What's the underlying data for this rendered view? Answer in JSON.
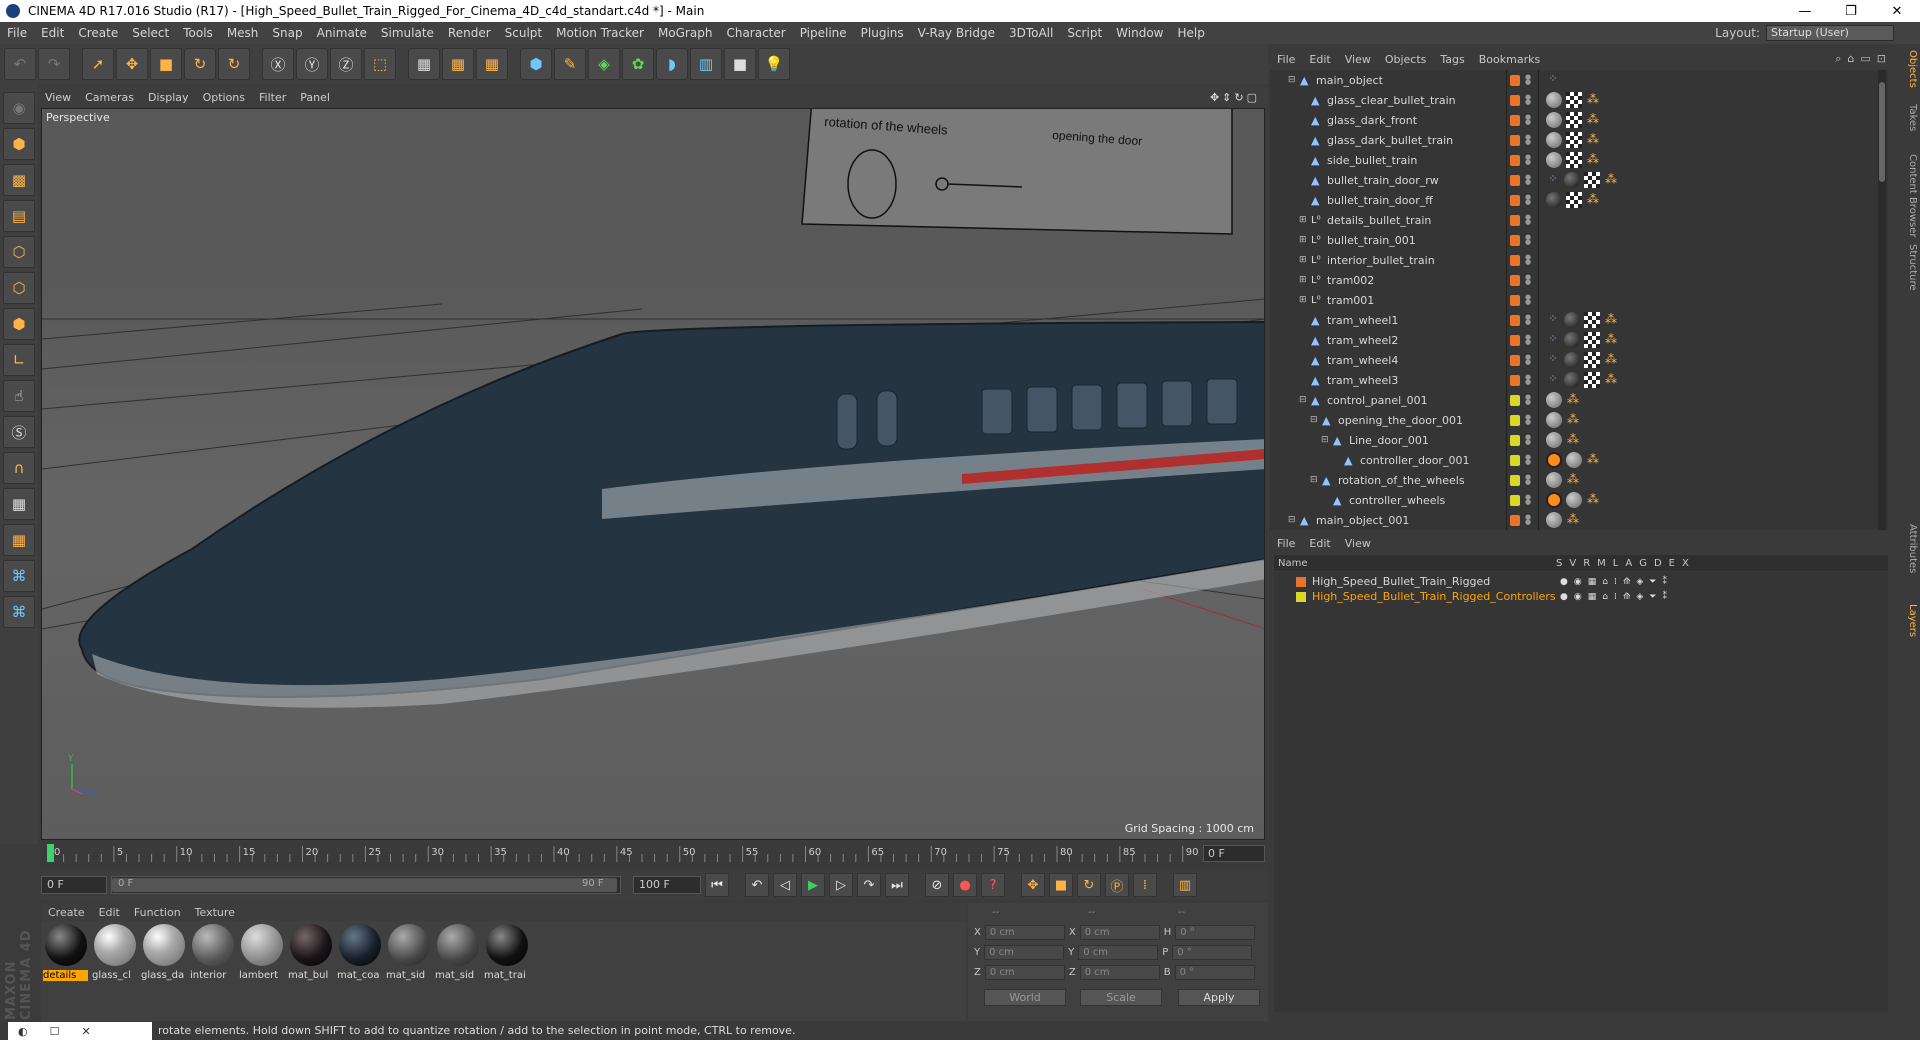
{
  "window": {
    "title": "CINEMA 4D R17.016 Studio (R17) - [High_Speed_Bullet_Train_Rigged_For_Cinema_4D_c4d_standart.c4d *] - Main"
  },
  "menubar": {
    "items": [
      "File",
      "Edit",
      "Create",
      "Select",
      "Tools",
      "Mesh",
      "Snap",
      "Animate",
      "Simulate",
      "Render",
      "Sculpt",
      "Motion Tracker",
      "MoGraph",
      "Character",
      "Pipeline",
      "Plugins",
      "V-Ray Bridge",
      "3DToAll",
      "Script",
      "Window",
      "Help"
    ],
    "layout_label": "Layout:",
    "layout_value": "Startup (User)"
  },
  "viewport": {
    "menu": [
      "View",
      "Cameras",
      "Display",
      "Options",
      "Filter",
      "Panel"
    ],
    "camera_label": "Perspective",
    "grid_spacing": "Grid Spacing : 1000 cm",
    "panel_text_wheels": "rotation of the wheels",
    "panel_text_door": "opening the door",
    "axis_y": "Y",
    "axis_z": "Z"
  },
  "timeline": {
    "ticks": [
      "0",
      "5",
      "10",
      "15",
      "20",
      "25",
      "30",
      "35",
      "40",
      "45",
      "50",
      "55",
      "60",
      "65",
      "70",
      "75",
      "80",
      "85",
      "90"
    ],
    "current_frame": "0 F"
  },
  "anim": {
    "start": "0 F",
    "range_start": "0 F",
    "range_end": "90 F",
    "end": "100 F"
  },
  "materials": {
    "menu": [
      "Create",
      "Edit",
      "Function",
      "Texture"
    ],
    "items": [
      {
        "name": "details",
        "style": "dark",
        "selected": true
      },
      {
        "name": "glass_cl",
        "style": "glass",
        "selected": false
      },
      {
        "name": "glass_da",
        "style": "glass",
        "selected": false
      },
      {
        "name": "interior",
        "style": "gray",
        "selected": false
      },
      {
        "name": "lambert",
        "style": "light",
        "selected": false
      },
      {
        "name": "mat_bul",
        "style": "darkred",
        "selected": false
      },
      {
        "name": "mat_coa",
        "style": "darkblue",
        "selected": false
      },
      {
        "name": "mat_sid",
        "style": "grayd",
        "selected": false
      },
      {
        "name": "mat_sid",
        "style": "grayd",
        "selected": false
      },
      {
        "name": "mat_trai",
        "style": "dark",
        "selected": false
      }
    ]
  },
  "coords": {
    "header": [
      "--",
      "--",
      "--"
    ],
    "rows": [
      {
        "l1": "X",
        "v1": "0 cm",
        "l2": "X",
        "v2": "0 cm",
        "l3": "H",
        "v3": "0 °"
      },
      {
        "l1": "Y",
        "v1": "0 cm",
        "l2": "Y",
        "v2": "0 cm",
        "l3": "P",
        "v3": "0 °"
      },
      {
        "l1": "Z",
        "v1": "0 cm",
        "l2": "Z",
        "v2": "0 cm",
        "l3": "B",
        "v3": "0 °"
      }
    ],
    "mode1": "World",
    "mode2": "Scale",
    "apply": "Apply"
  },
  "status": {
    "text": "rotate elements. Hold down SHIFT to add to quantize rotation / add to the selection in point mode, CTRL to remove."
  },
  "objects": {
    "menu": [
      "File",
      "Edit",
      "View",
      "Objects",
      "Tags",
      "Bookmarks"
    ],
    "rows": [
      {
        "name": "main_object",
        "depth": 0,
        "icon": "bone",
        "exp": "⊟",
        "color": "#e8742a",
        "tags": [
          "sk"
        ]
      },
      {
        "name": "glass_clear_bullet_train",
        "depth": 1,
        "icon": "bone",
        "exp": "",
        "color": "#e8742a",
        "tags": [
          "gray",
          "chk",
          "xp"
        ]
      },
      {
        "name": "glass_dark_front",
        "depth": 1,
        "icon": "bone",
        "exp": "",
        "color": "#e8742a",
        "tags": [
          "gray",
          "chk",
          "xp"
        ]
      },
      {
        "name": "glass_dark_bullet_train",
        "depth": 1,
        "icon": "bone",
        "exp": "",
        "color": "#e8742a",
        "tags": [
          "gray",
          "chk",
          "xp"
        ]
      },
      {
        "name": "side_bullet_train",
        "depth": 1,
        "icon": "bone",
        "exp": "",
        "color": "#e8742a",
        "tags": [
          "gray",
          "chk",
          "xp"
        ]
      },
      {
        "name": "bullet_train_door_rw",
        "depth": 1,
        "icon": "bone",
        "exp": "",
        "color": "#e8742a",
        "tags": [
          "sk",
          "dark",
          "chk",
          "xp"
        ]
      },
      {
        "name": "bullet_train_door_ff",
        "depth": 1,
        "icon": "bone",
        "exp": "",
        "color": "#e8742a",
        "tags": [
          "dark",
          "chk",
          "xp"
        ]
      },
      {
        "name": "details_bullet_train",
        "depth": 1,
        "icon": "null",
        "exp": "⊞",
        "color": "#e8742a",
        "tags": []
      },
      {
        "name": "bullet_train_001",
        "depth": 1,
        "icon": "null",
        "exp": "⊞",
        "color": "#e8742a",
        "tags": []
      },
      {
        "name": "interior_bullet_train",
        "depth": 1,
        "icon": "null",
        "exp": "⊞",
        "color": "#e8742a",
        "tags": []
      },
      {
        "name": "tram002",
        "depth": 1,
        "icon": "null",
        "exp": "⊞",
        "color": "#e8742a",
        "tags": []
      },
      {
        "name": "tram001",
        "depth": 1,
        "icon": "null",
        "exp": "⊞",
        "color": "#e8742a",
        "tags": []
      },
      {
        "name": "tram_wheel1",
        "depth": 1,
        "icon": "bone",
        "exp": "",
        "color": "#e8742a",
        "tags": [
          "sk",
          "dark",
          "chk",
          "xp"
        ]
      },
      {
        "name": "tram_wheel2",
        "depth": 1,
        "icon": "bone",
        "exp": "",
        "color": "#e8742a",
        "tags": [
          "sk",
          "dark",
          "chk",
          "xp"
        ]
      },
      {
        "name": "tram_wheel4",
        "depth": 1,
        "icon": "bone",
        "exp": "",
        "color": "#e8742a",
        "tags": [
          "sk",
          "dark",
          "chk",
          "xp"
        ]
      },
      {
        "name": "tram_wheel3",
        "depth": 1,
        "icon": "bone",
        "exp": "",
        "color": "#e8742a",
        "tags": [
          "sk",
          "dark",
          "chk",
          "xp"
        ]
      },
      {
        "name": "control_panel_001",
        "depth": 1,
        "icon": "bone",
        "exp": "⊟",
        "color": "#d8d82a",
        "tags": [
          "gray",
          "xp"
        ]
      },
      {
        "name": "opening_the_door_001",
        "depth": 2,
        "icon": "bone",
        "exp": "⊟",
        "color": "#d8d82a",
        "tags": [
          "gray",
          "xp"
        ]
      },
      {
        "name": "Line_door_001",
        "depth": 3,
        "icon": "bone",
        "exp": "⊟",
        "color": "#d8d82a",
        "tags": [
          "gray",
          "xp"
        ]
      },
      {
        "name": "controller_door_001",
        "depth": 4,
        "icon": "bone",
        "exp": "",
        "color": "#d8d82a",
        "tags": [
          "nul",
          "gray",
          "xp"
        ]
      },
      {
        "name": "rotation_of_the_wheels",
        "depth": 2,
        "icon": "bone",
        "exp": "⊟",
        "color": "#d8d82a",
        "tags": [
          "gray",
          "xp"
        ]
      },
      {
        "name": "controller_wheels",
        "depth": 3,
        "icon": "bone",
        "exp": "",
        "color": "#d8d82a",
        "tags": [
          "nul",
          "gray",
          "xp"
        ]
      },
      {
        "name": "main_object_001",
        "depth": 0,
        "icon": "bone",
        "exp": "⊟",
        "color": "#e8742a",
        "tags": [
          "gray",
          "xp"
        ]
      }
    ]
  },
  "layers": {
    "menu": [
      "File",
      "Edit",
      "View"
    ],
    "head_name": "Name",
    "head_flags": [
      "S",
      "V",
      "R",
      "M",
      "L",
      "A",
      "G",
      "D",
      "E",
      "X"
    ],
    "rows": [
      {
        "name": "High_Speed_Bullet_Train_Rigged",
        "color": "#e8742a",
        "text_color": "#d8d8d8"
      },
      {
        "name": "High_Speed_Bullet_Train_Rigged_Controllers",
        "color": "#d8d82a",
        "text_color": "#ffa500"
      }
    ]
  },
  "sidetabs": [
    "Objects",
    "Takes",
    "Content Browser",
    "Structure",
    "Attributes",
    "Layers"
  ]
}
